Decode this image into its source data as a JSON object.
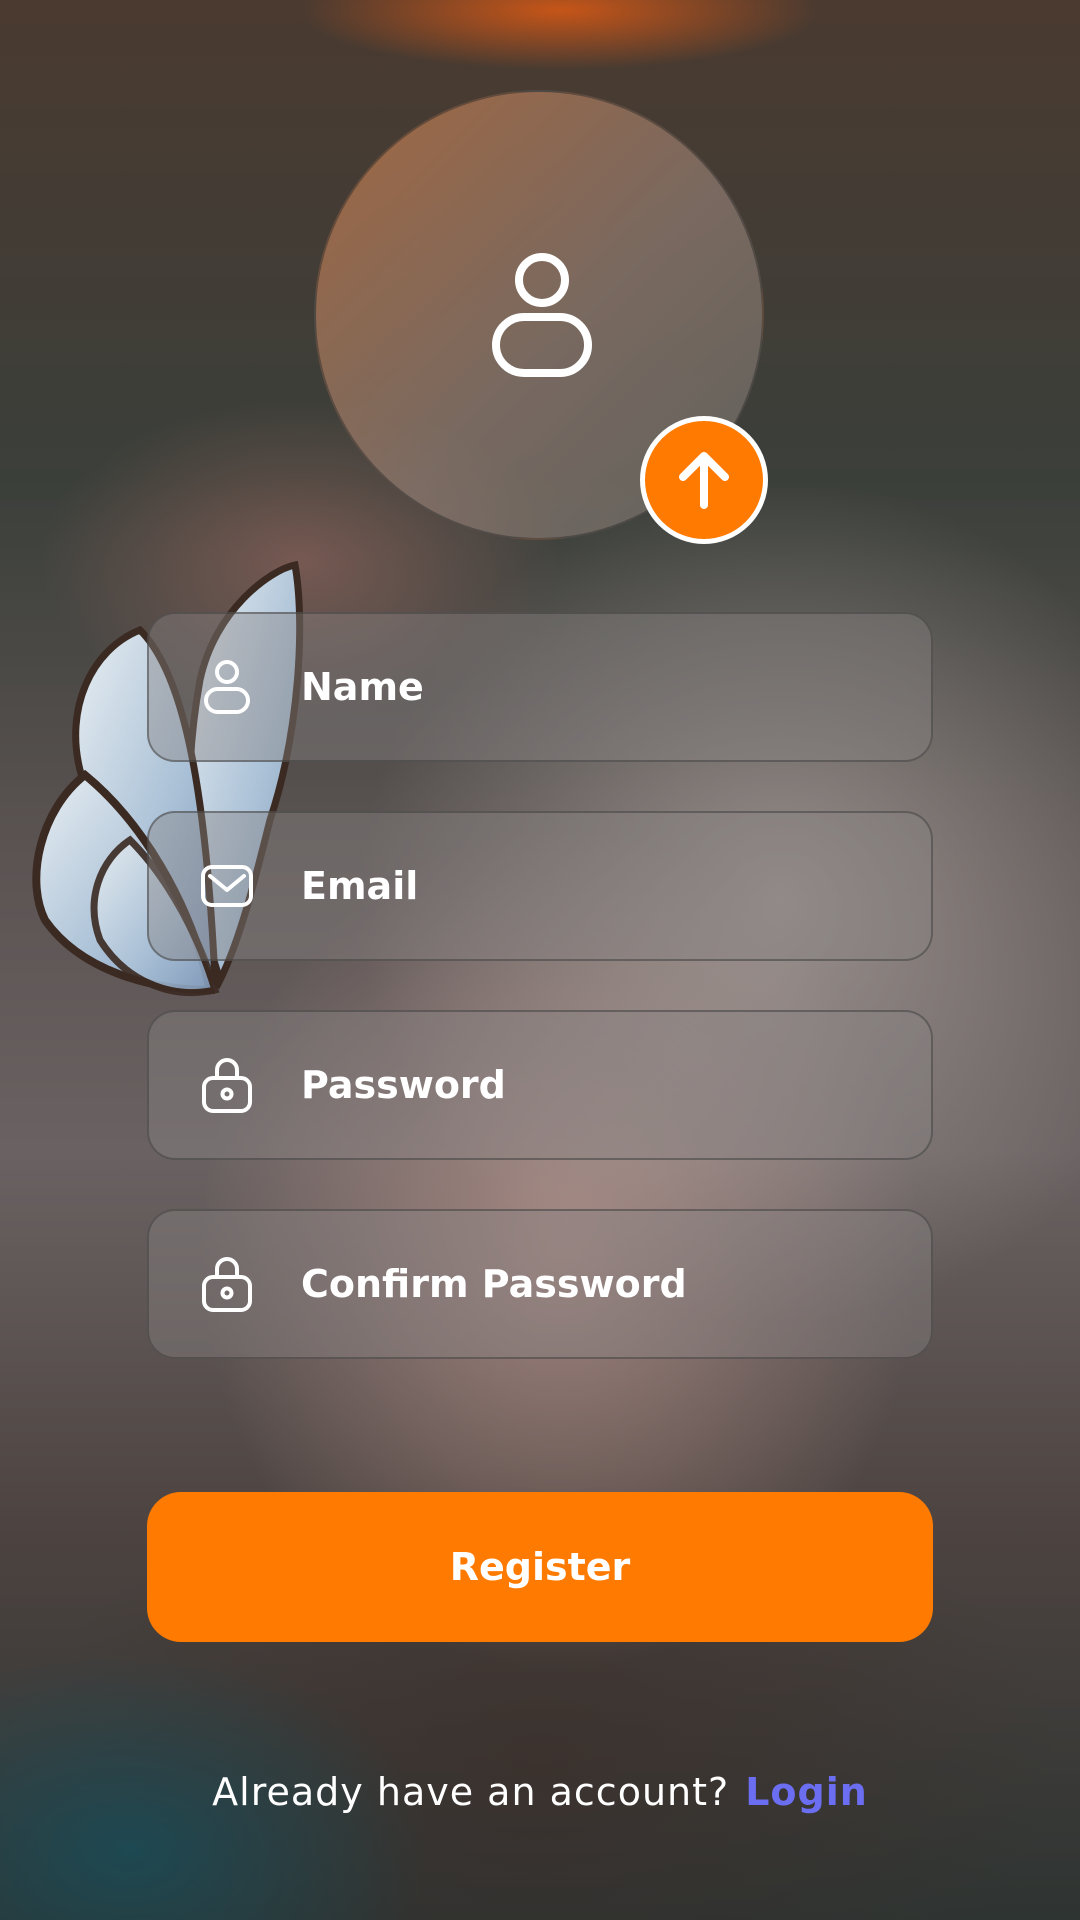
{
  "colors": {
    "accent": "#ff7a00",
    "link": "#6c6ef2",
    "text": "#ffffff"
  },
  "avatar": {
    "icon": "user-icon",
    "upload_icon": "arrow-up-icon"
  },
  "form": {
    "name": {
      "placeholder": "Name",
      "icon": "user-icon"
    },
    "email": {
      "placeholder": "Email",
      "icon": "mail-icon"
    },
    "password": {
      "placeholder": "Password",
      "icon": "lock-icon"
    },
    "confirm_password": {
      "placeholder": "Confirm Password",
      "icon": "lock-icon"
    }
  },
  "register_label": "Register",
  "footer": {
    "prompt": "Already have an account?",
    "login_label": "Login"
  }
}
